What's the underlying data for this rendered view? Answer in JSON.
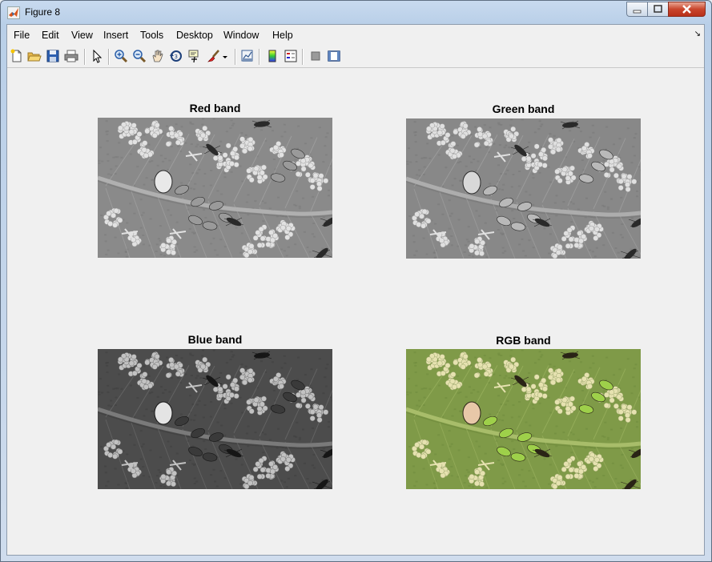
{
  "window": {
    "title": "Figure 8"
  },
  "menu": [
    "File",
    "Edit",
    "View",
    "Insert",
    "Tools",
    "Desktop",
    "Window",
    "Help"
  ],
  "toolbar_icons": [
    "new-figure-icon",
    "open-file-icon",
    "save-icon",
    "print-icon",
    "pointer-icon",
    "zoom-in-icon",
    "zoom-out-icon",
    "pan-hand-icon",
    "rotate-3d-icon",
    "data-cursor-icon",
    "brush-icon",
    "brush-dropdown-icon",
    "link-plot-icon",
    "colorbar-icon",
    "legend-icon",
    "hide-plot-tools-icon",
    "show-plot-tools-icon"
  ],
  "axes": [
    {
      "title": "Red band",
      "band": "red"
    },
    {
      "title": "Green band",
      "band": "green"
    },
    {
      "title": "Blue band",
      "band": "blue"
    },
    {
      "title": "RGB band",
      "band": "rgb"
    }
  ],
  "colors": {
    "red_band_bg": "#8a8a8a",
    "green_band_bg": "#888888",
    "blue_band_bg": "#4a4a4a",
    "rgb_bg": "#7f9a48",
    "rgb_eggs": "#e6e2b0",
    "rgb_aphid": "#9ed04a"
  }
}
